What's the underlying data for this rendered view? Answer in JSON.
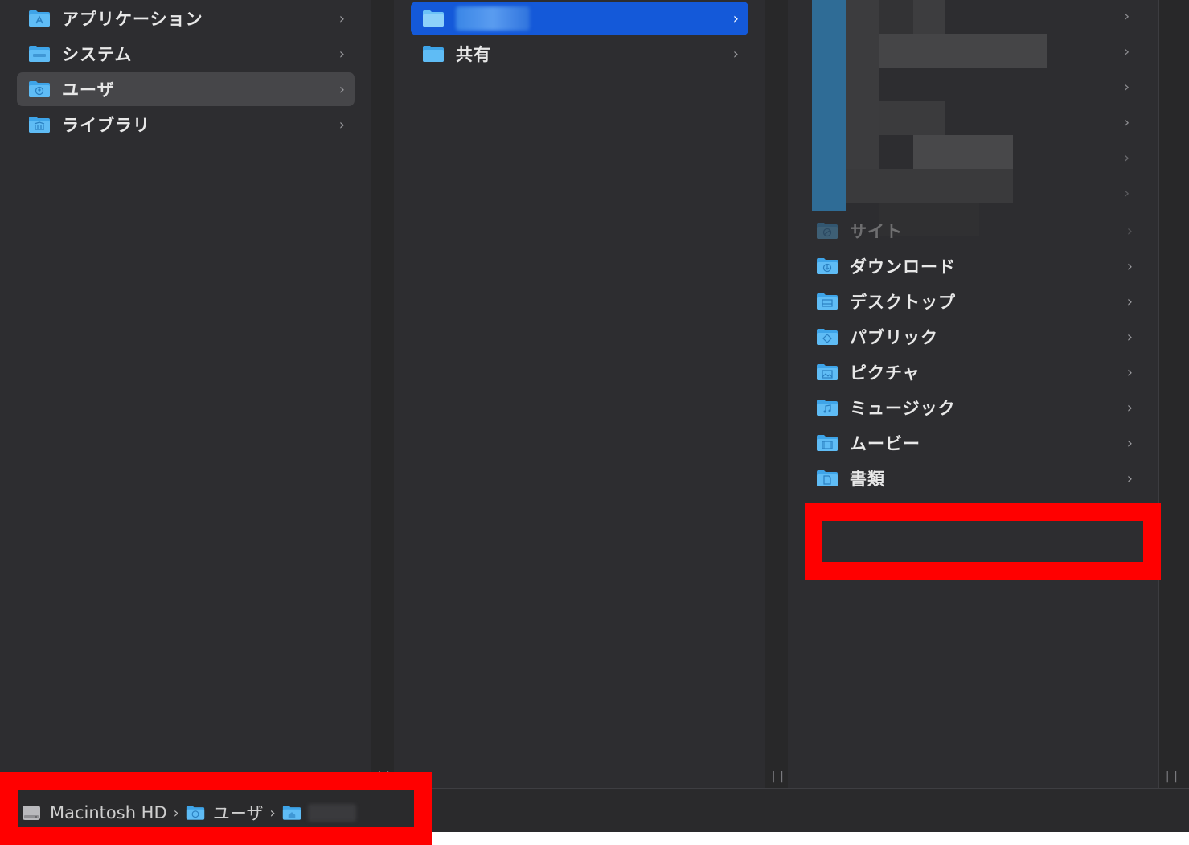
{
  "columns": {
    "root": {
      "items": [
        {
          "label": "アプリケーション",
          "icon": "applications-folder-icon"
        },
        {
          "label": "システム",
          "icon": "macos-folder-icon"
        },
        {
          "label": "ユーザ",
          "icon": "users-folder-icon",
          "selected": true
        },
        {
          "label": "ライブラリ",
          "icon": "library-folder-icon"
        }
      ]
    },
    "users": {
      "items": [
        {
          "label": "",
          "icon": "home-folder-icon",
          "selected": true
        },
        {
          "label": "共有",
          "icon": "folder-icon"
        }
      ]
    },
    "home": {
      "items": [
        {
          "label": "サイト",
          "icon": "sites-folder-icon"
        },
        {
          "label": "ダウンロード",
          "icon": "downloads-folder-icon"
        },
        {
          "label": "デスクトップ",
          "icon": "desktop-folder-icon"
        },
        {
          "label": "パブリック",
          "icon": "public-folder-icon"
        },
        {
          "label": "ピクチャ",
          "icon": "pictures-folder-icon"
        },
        {
          "label": "ミュージック",
          "icon": "music-folder-icon"
        },
        {
          "label": "ムービー",
          "icon": "movies-folder-icon"
        },
        {
          "label": "書類",
          "icon": "documents-folder-icon"
        }
      ]
    }
  },
  "chevron": "›",
  "resize_handle": "||",
  "pathbar": {
    "crumbs": [
      {
        "label": "Macintosh HD",
        "icon": "hard-drive-icon"
      },
      {
        "label": "ユーザ",
        "icon": "users-folder-icon"
      },
      {
        "label": "",
        "icon": "home-folder-icon"
      }
    ],
    "separator": "›"
  },
  "colors": {
    "window_bg": "#2d2d30",
    "selection_blue": "#1459d9",
    "selection_gray": "#464649",
    "folder_blue": "#3ea4e8",
    "highlight_red": "#ff0000"
  }
}
